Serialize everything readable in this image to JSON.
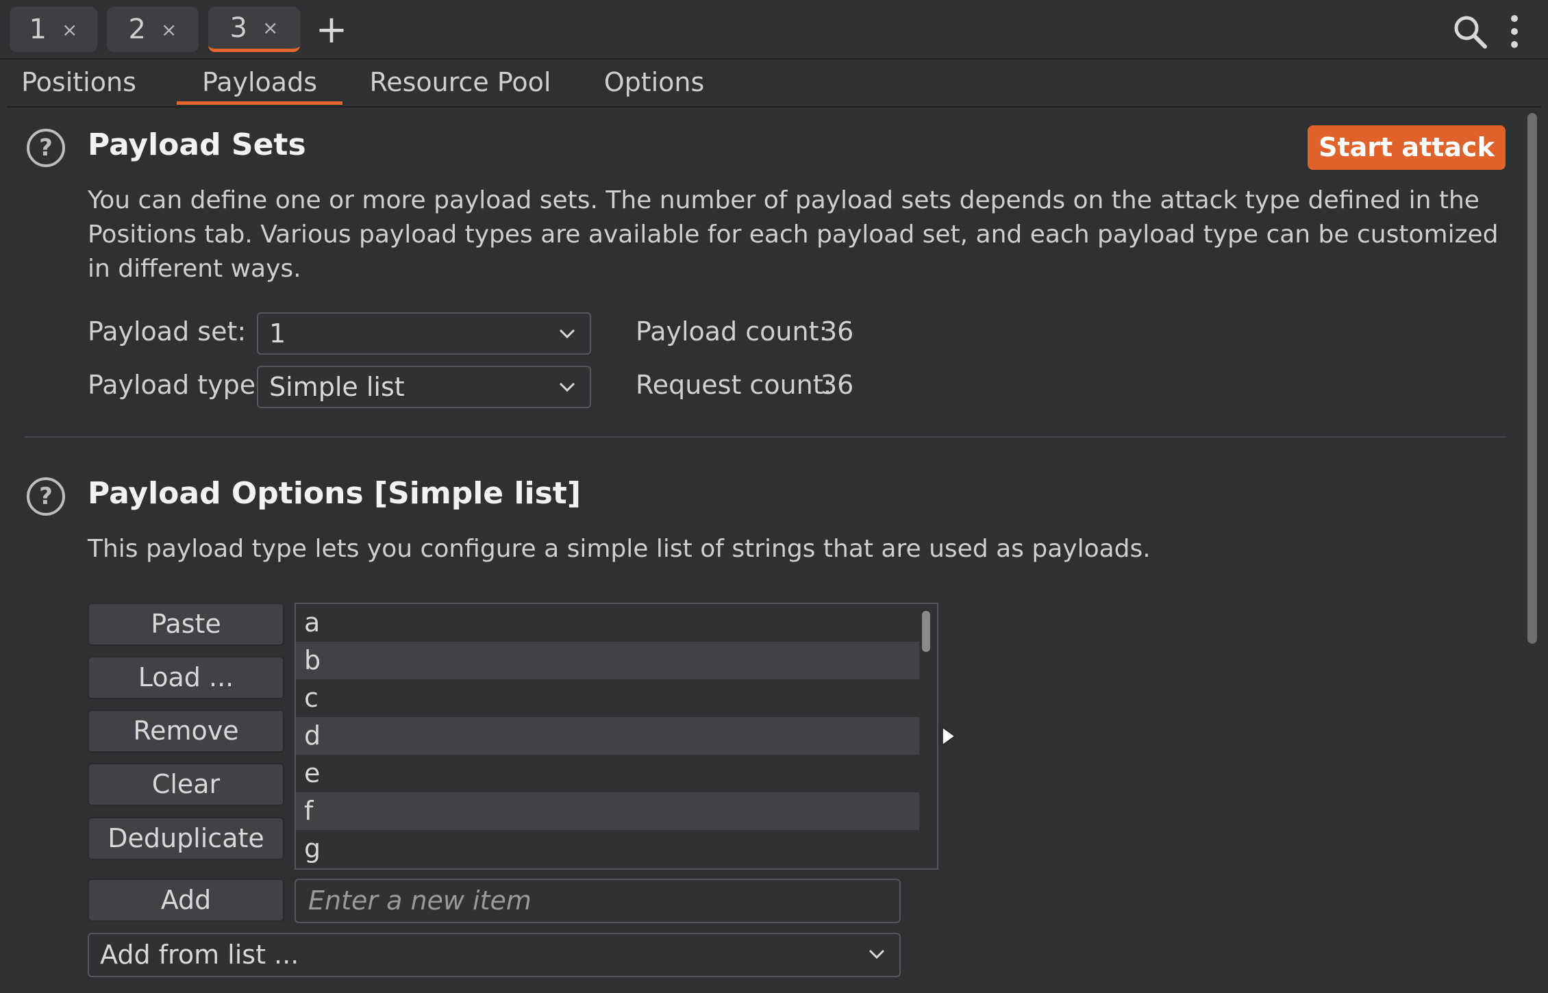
{
  "instance_tabs": [
    {
      "label": "1",
      "close": "×"
    },
    {
      "label": "2",
      "close": "×"
    },
    {
      "label": "3",
      "close": "×",
      "active": true
    }
  ],
  "add_tab_label": "+",
  "icons": {
    "search": "search-icon",
    "menu": "kebab-menu-icon",
    "help": "help-icon",
    "chevron": "chevron-down-icon"
  },
  "sub_tabs": [
    "Positions",
    "Payloads",
    "Resource Pool",
    "Options"
  ],
  "active_sub_tab": "Payloads",
  "payload_sets": {
    "title": "Payload Sets",
    "start_attack": "Start attack",
    "description": "You can define one or more payload sets. The number of payload sets depends on the attack type defined in the Positions tab. Various payload types are available for each payload set, and each payload type can be customized in different ways.",
    "payload_set_label": "Payload set:",
    "payload_set_value": "1",
    "payload_type_label": "Payload type:",
    "payload_type_value": "Simple list",
    "payload_count_label": "Payload count:",
    "payload_count_value": "36",
    "request_count_label": "Request count:",
    "request_count_value": "36"
  },
  "payload_options": {
    "title": "Payload Options [Simple list]",
    "description": "This payload type lets you configure a simple list of strings that are used as payloads.",
    "buttons": {
      "paste": "Paste",
      "load": "Load ...",
      "remove": "Remove",
      "clear": "Clear",
      "deduplicate": "Deduplicate",
      "add": "Add"
    },
    "list_items": [
      "a",
      "b",
      "c",
      "d",
      "e",
      "f",
      "g"
    ],
    "new_item_placeholder": "Enter a new item",
    "add_from_list": "Add from list ..."
  },
  "colors": {
    "accent": "#e4672d",
    "start_button": "#e0622a",
    "background": "#2f3032"
  }
}
